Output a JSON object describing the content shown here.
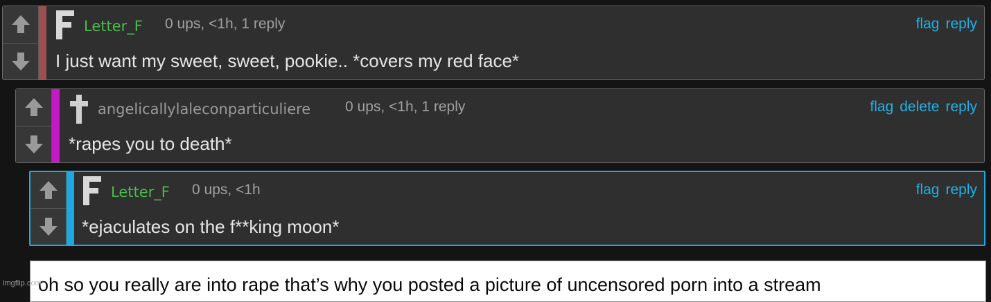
{
  "colors": {
    "background": "#141414",
    "card": "#2f2f2f",
    "link": "#1fb2e8",
    "username_green": "#4cbb4c",
    "username_gray": "#9a9a9a",
    "strip_brown": "#9b4f4f",
    "strip_magenta": "#c41ac4",
    "strip_blue": "#1aa9e0"
  },
  "icons": {
    "upvote": "up-arrow-icon",
    "downvote": "down-arrow-icon"
  },
  "comments": [
    {
      "avatar_glyph": "F",
      "username": "Letter_F",
      "meta": "0 ups, <1h, 1 reply",
      "actions": [
        "flag",
        "reply"
      ],
      "text": "I just want my sweet, sweet, pookie.. *covers my red face*"
    },
    {
      "avatar_glyph": "✝",
      "username": "angelicallylaleconparticuliere",
      "meta": "0 ups, <1h, 1 reply",
      "actions": [
        "flag",
        "delete",
        "reply"
      ],
      "text": "*rapes you to death*"
    },
    {
      "avatar_glyph": "F",
      "username": "Letter_F",
      "meta": "0 ups, <1h",
      "actions": [
        "flag",
        "reply"
      ],
      "text": "*ejaculates on the f**king moon*"
    }
  ],
  "reply_box": {
    "text": "oh so you really are into rape that’s why you posted a picture of uncensored porn into a stream"
  },
  "watermark": "imgflip.com"
}
